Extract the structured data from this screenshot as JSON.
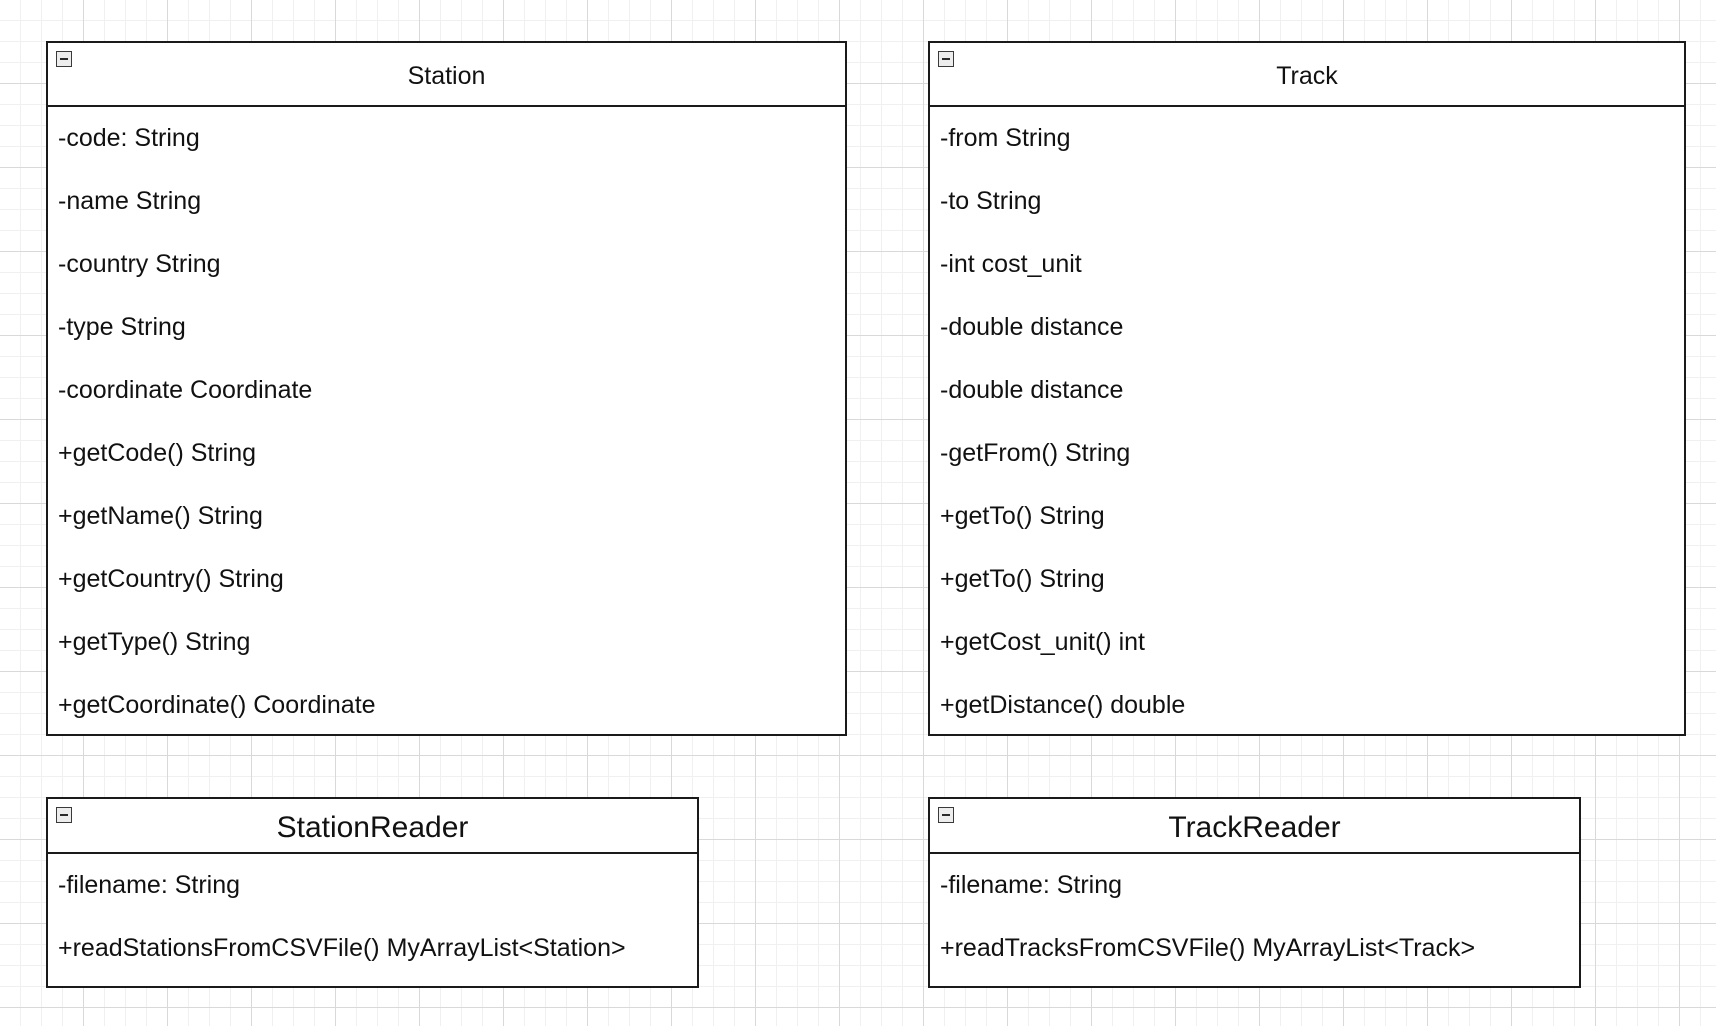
{
  "classes": {
    "station": {
      "name": "Station",
      "members": [
        "-code: String",
        "-name String",
        "-country String",
        "-type String",
        "-coordinate Coordinate",
        "+getCode() String",
        "+getName() String",
        "+getCountry() String",
        "+getType() String",
        "+getCoordinate() Coordinate"
      ]
    },
    "track": {
      "name": "Track",
      "members": [
        "-from String",
        "-to String",
        "-int cost_unit",
        "-double distance",
        "-double distance",
        "-getFrom() String",
        "+getTo() String",
        "+getTo() String",
        "+getCost_unit() int",
        "+getDistance() double"
      ]
    },
    "station_reader": {
      "name": "StationReader",
      "members": [
        "-filename: String",
        "+readStationsFromCSVFile() MyArrayList<Station>"
      ]
    },
    "track_reader": {
      "name": "TrackReader",
      "members": [
        "-filename: String",
        "+readTracksFromCSVFile() MyArrayList<Track>"
      ]
    }
  }
}
